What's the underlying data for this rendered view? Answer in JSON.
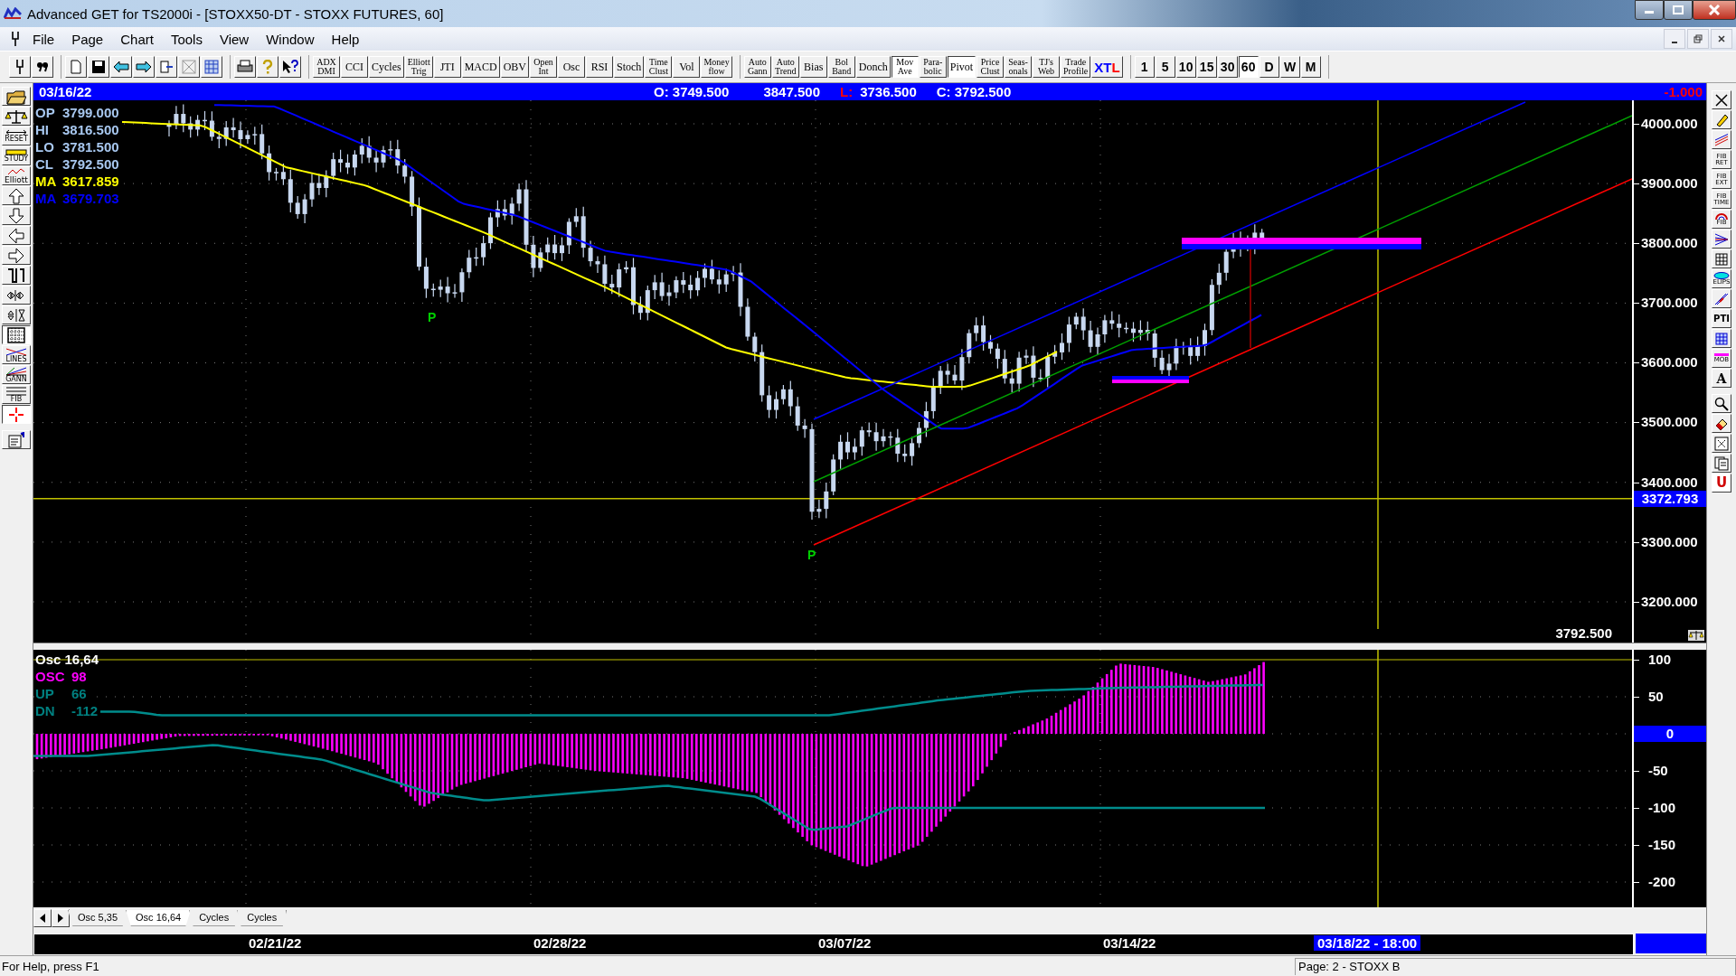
{
  "window": {
    "title": "Advanced GET for TS2000i - [STOXX50-DT - STOXX FUTURES, 60]"
  },
  "menu": [
    "File",
    "Page",
    "Chart",
    "Tools",
    "View",
    "Window",
    "Help"
  ],
  "study_buttons": [
    {
      "lines": [
        "ADX",
        "DMI"
      ],
      "selected": false
    },
    {
      "lines": [
        "CCI"
      ],
      "selected": false
    },
    {
      "lines": [
        "Cycles"
      ],
      "selected": false
    },
    {
      "lines": [
        "Elliott",
        "Trig"
      ],
      "selected": false
    },
    {
      "lines": [
        "JTI"
      ],
      "selected": false
    },
    {
      "lines": [
        "MACD"
      ],
      "selected": false
    },
    {
      "lines": [
        "OBV"
      ],
      "selected": false
    },
    {
      "lines": [
        "Open",
        "Int"
      ],
      "selected": false
    },
    {
      "lines": [
        "Osc"
      ],
      "selected": false
    },
    {
      "lines": [
        "RSI"
      ],
      "selected": false
    },
    {
      "lines": [
        "Stoch"
      ],
      "selected": false
    },
    {
      "lines": [
        "Time",
        "Clust"
      ],
      "selected": false
    },
    {
      "lines": [
        "Vol"
      ],
      "selected": false
    },
    {
      "lines": [
        "Money",
        "flow"
      ],
      "selected": false
    }
  ],
  "overlay_buttons": [
    {
      "lines": [
        "Auto",
        "Gann"
      ],
      "selected": false
    },
    {
      "lines": [
        "Auto",
        "Trend"
      ],
      "selected": false
    },
    {
      "lines": [
        "Bias"
      ],
      "selected": false
    },
    {
      "lines": [
        "Bol",
        "Band"
      ],
      "selected": false
    },
    {
      "lines": [
        "Donch"
      ],
      "selected": false
    },
    {
      "lines": [
        "Mov",
        "Ave"
      ],
      "selected": true
    },
    {
      "lines": [
        "Para-",
        "bolic"
      ],
      "selected": false
    },
    {
      "lines": [
        "Pivot"
      ],
      "selected": true
    },
    {
      "lines": [
        "Price",
        "Clust"
      ],
      "selected": false
    },
    {
      "lines": [
        "Seas-",
        "onals"
      ],
      "selected": false
    },
    {
      "lines": [
        "TJ's",
        "Web"
      ],
      "selected": false
    },
    {
      "lines": [
        "Trade",
        "Profile"
      ],
      "selected": false
    }
  ],
  "xtl_button": {
    "parts": [
      {
        "text": "X",
        "color": "#0000ff"
      },
      {
        "text": "T",
        "color": "#0000ff"
      },
      {
        "text": "L",
        "color": "#ff0000"
      }
    ]
  },
  "interval_buttons": [
    {
      "label": "1",
      "selected": false
    },
    {
      "label": "5",
      "selected": false
    },
    {
      "label": "10",
      "selected": false
    },
    {
      "label": "15",
      "selected": false
    },
    {
      "label": "30",
      "selected": false
    },
    {
      "label": "60",
      "selected": true
    },
    {
      "label": "D",
      "selected": false
    },
    {
      "label": "W",
      "selected": false
    },
    {
      "label": "M",
      "selected": false
    }
  ],
  "left_toolbar_labels": [
    "RESET",
    "STUDY",
    "Elliott",
    "LINES",
    "GANN",
    "FIB"
  ],
  "right_toolbar_labels": [
    [
      "FIB",
      "RET"
    ],
    [
      "FIB",
      "EXT"
    ],
    [
      "FIB",
      "TIME"
    ],
    [
      "FIB"
    ],
    [
      "ELIPS"
    ],
    [
      "PTI"
    ],
    [
      "MOB"
    ],
    [
      "A"
    ],
    [
      "U"
    ]
  ],
  "header": {
    "date": "03/16/22",
    "open": "O: 3749.500",
    "high": "3847.500",
    "low_label": "L:",
    "low": "3736.500",
    "close": "C: 3792.500",
    "change": "-1.000"
  },
  "info_panel": [
    {
      "label": "OP",
      "value": "3799.000",
      "color": "#a8c8f0"
    },
    {
      "label": "HI",
      "value": "3816.500",
      "color": "#a8c8f0"
    },
    {
      "label": "LO",
      "value": "3781.500",
      "color": "#a8c8f0"
    },
    {
      "label": "CL",
      "value": "3792.500",
      "color": "#a8c8f0"
    },
    {
      "label": "MA",
      "value": "3617.859",
      "color": "#ffff00"
    },
    {
      "label": "MA",
      "value": "3679.703",
      "color": "#0000ff"
    }
  ],
  "pivot_marks": [
    "P",
    "P"
  ],
  "price_axis": {
    "ticks": [
      "4000.000",
      "3900.000",
      "3800.000",
      "3700.000",
      "3600.000",
      "3500.000",
      "3400.000",
      "3300.000",
      "3200.000"
    ],
    "cursor": "3372.793",
    "last": "3792.500"
  },
  "osc_panel": {
    "title": "Osc 16,64",
    "values": [
      {
        "label": "OSC",
        "value": "98",
        "color": "#ff00ff"
      },
      {
        "label": "UP",
        "value": "66",
        "color": "#008080"
      },
      {
        "label": "DN",
        "value": "-112",
        "color": "#008080"
      }
    ]
  },
  "osc_axis": {
    "ticks": [
      "100",
      "50",
      "-50",
      "-100",
      "-150",
      "-200"
    ],
    "zero": "0"
  },
  "tabs": [
    {
      "label": "Osc 5,35",
      "selected": false
    },
    {
      "label": "Osc 16,64",
      "selected": true
    },
    {
      "label": "Cycles",
      "selected": false
    },
    {
      "label": "Cycles",
      "selected": false
    }
  ],
  "date_axis": {
    "dates": [
      "02/21/22",
      "02/28/22",
      "03/07/22",
      "03/14/22"
    ],
    "cursor": "03/18/22 - 18:00"
  },
  "status_bar": {
    "help": "For Help, press F1",
    "page": "Page: 2 - STOXX B"
  }
}
